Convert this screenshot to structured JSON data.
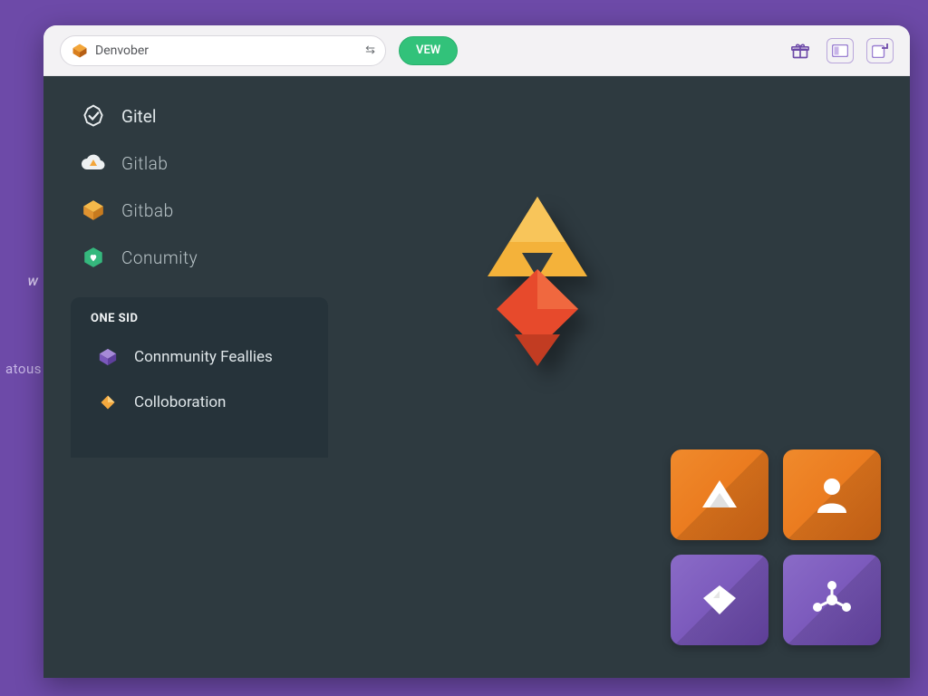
{
  "purple_strip": {
    "w": "w",
    "atous": "atous"
  },
  "chrome": {
    "address_text": "Denvober",
    "arrows_glyph": "⇆",
    "view_label": "VEW"
  },
  "sidebar": {
    "items": [
      {
        "label": "Gitel"
      },
      {
        "label": "Gitlab"
      },
      {
        "label": "Gitbab"
      },
      {
        "label": "Conumity"
      }
    ]
  },
  "section": {
    "title": "ONE SID",
    "items": [
      {
        "label": "Connmunity Feallies"
      },
      {
        "label": "Colloboration"
      }
    ]
  },
  "tiles": [
    {
      "name": "triangle-tile"
    },
    {
      "name": "person-tile"
    },
    {
      "name": "heart-tile"
    },
    {
      "name": "nodes-tile"
    }
  ]
}
